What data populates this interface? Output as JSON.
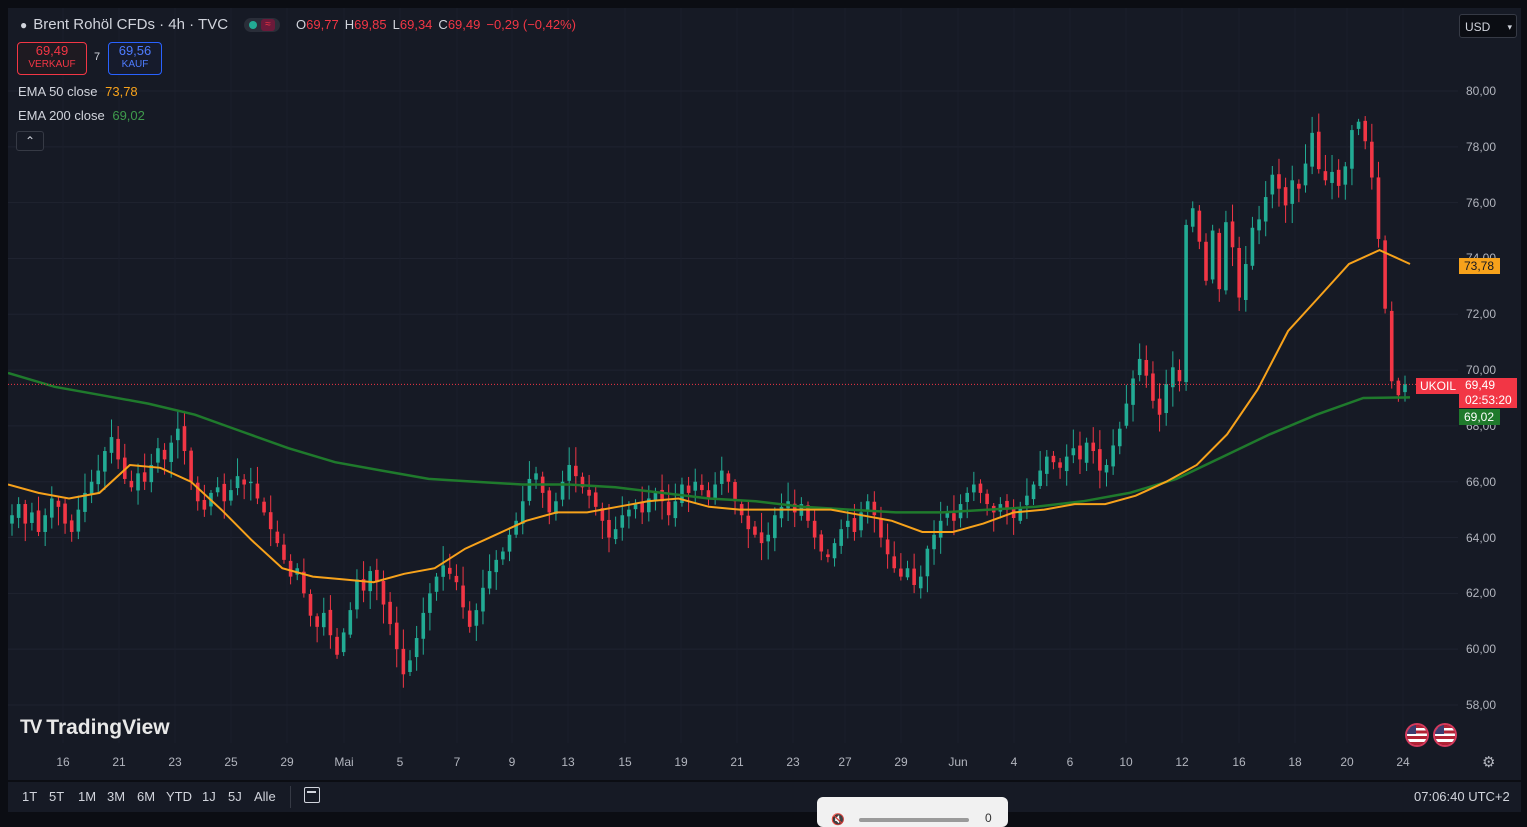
{
  "header": {
    "symbol_title": "Brent Rohöl CFDs · 4h · TVC",
    "ohlc": [
      {
        "k": "O",
        "v": "69,77"
      },
      {
        "k": "H",
        "v": "69,85"
      },
      {
        "k": "L",
        "v": "69,34"
      },
      {
        "k": "C",
        "v": "69,49"
      },
      {
        "k": "",
        "v": "−0,29 (−0,42%)"
      }
    ],
    "sell_price": "69,49",
    "sell_label": "VERKAUF",
    "spread": "7",
    "buy_price": "69,56",
    "buy_label": "KAUF",
    "ema50_label": "EMA 50 close",
    "ema50_value": "73,78",
    "ema200_label": "EMA 200 close",
    "ema200_value": "69,02",
    "collapse_glyph": "⌃",
    "currency": "USD",
    "currency_chevron": "▾"
  },
  "price_axis": [
    "80,00",
    "78,00",
    "76,00",
    "74,00",
    "72,00",
    "70,00",
    "68,00",
    "66,00",
    "64,00",
    "62,00",
    "60,00",
    "58,00"
  ],
  "date_axis": [
    "16",
    "21",
    "23",
    "25",
    "29",
    "Mai",
    "5",
    "7",
    "9",
    "13",
    "15",
    "19",
    "21",
    "23",
    "27",
    "29",
    "Jun",
    "4",
    "6",
    "10",
    "12",
    "16",
    "18",
    "20",
    "24"
  ],
  "tags": {
    "symbol": "UKOIL",
    "last_price": "69,49",
    "countdown": "02:53:20",
    "ema50": "73,78",
    "ema200": "69,02"
  },
  "brand": {
    "mark": "TV",
    "name": "TradingView"
  },
  "range_buttons": [
    "1T",
    "5T",
    "1M",
    "3M",
    "6M",
    "YTD",
    "1J",
    "5J",
    "Alle"
  ],
  "clock": "07:06:40 UTC+2",
  "audio": {
    "volume": "0",
    "mute_glyph": "🔇"
  },
  "colors": {
    "up": "#22ab94",
    "down": "#f23645",
    "ema50": "#f7a21b",
    "ema200": "#1f7a2c",
    "background": "#161a25"
  },
  "series": {
    "y_range": [
      57.3,
      80.7
    ],
    "closes": [
      64.8,
      65.2,
      64.5,
      64.9,
      64.2,
      64.8,
      65.4,
      65.1,
      64.5,
      64.2,
      65.0,
      65.6,
      66.0,
      66.4,
      67.1,
      67.6,
      66.8,
      66.1,
      65.8,
      66.3,
      66.0,
      66.6,
      67.2,
      66.8,
      67.4,
      67.9,
      67.1,
      66.0,
      65.3,
      65.0,
      65.6,
      65.8,
      65.3,
      65.7,
      66.2,
      65.9,
      66.0,
      65.4,
      64.9,
      64.3,
      63.8,
      63.2,
      62.6,
      62.9,
      62.0,
      61.2,
      60.8,
      61.3,
      60.5,
      59.8,
      60.6,
      61.4,
      62.5,
      62.1,
      62.8,
      62.4,
      61.6,
      60.9,
      60.0,
      59.1,
      59.6,
      60.4,
      61.3,
      62.0,
      62.6,
      63.0,
      62.7,
      62.4,
      61.5,
      60.8,
      61.4,
      62.2,
      62.8,
      63.2,
      63.5,
      64.1,
      64.6,
      65.3,
      66.1,
      66.3,
      65.6,
      64.9,
      65.3,
      66.0,
      66.6,
      66.2,
      65.8,
      65.5,
      65.1,
      64.6,
      64.0,
      64.3,
      64.8,
      65.0,
      65.2,
      64.9,
      65.4,
      65.6,
      65.3,
      64.8,
      65.3,
      65.9,
      65.6,
      66.0,
      65.7,
      65.4,
      65.9,
      66.4,
      66.0,
      65.3,
      64.8,
      64.3,
      64.1,
      63.8,
      64.1,
      64.8,
      65.1,
      65.3,
      64.9,
      65.2,
      64.6,
      64.0,
      63.5,
      63.3,
      63.8,
      64.3,
      64.6,
      64.2,
      64.9,
      65.3,
      64.8,
      64.0,
      63.4,
      62.9,
      62.6,
      62.9,
      62.3,
      62.6,
      63.6,
      64.1,
      64.6,
      64.9,
      64.6,
      65.2,
      65.6,
      65.9,
      65.6,
      65.2,
      64.9,
      65.2,
      65.0,
      64.7,
      65.1,
      65.5,
      65.9,
      66.4,
      66.9,
      66.7,
      66.5,
      66.9,
      67.2,
      66.8,
      67.4,
      67.1,
      66.4,
      66.6,
      67.3,
      67.9,
      68.8,
      69.7,
      70.4,
      69.8,
      68.9,
      68.4,
      69.5,
      70.1,
      69.6,
      75.2,
      75.8,
      74.6,
      73.2,
      75.0,
      72.9,
      75.3,
      74.4,
      72.6,
      73.8,
      75.1,
      75.4,
      76.2,
      77.0,
      76.5,
      75.9,
      76.8,
      76.5,
      77.4,
      78.5,
      77.2,
      76.8,
      77.1,
      76.6,
      77.3,
      78.6,
      78.9,
      78.2,
      76.9,
      74.7,
      72.2,
      69.6,
      69.1,
      69.49
    ],
    "ema50": [
      65.9,
      65.6,
      65.4,
      65.6,
      66.6,
      66.5,
      66.0,
      65.0,
      63.9,
      62.9,
      62.6,
      62.5,
      62.4,
      62.7,
      62.9,
      63.6,
      64.1,
      64.6,
      64.9,
      64.9,
      65.1,
      65.3,
      65.4,
      65.1,
      65.0,
      65.0,
      65.0,
      65.0,
      64.8,
      64.6,
      64.2,
      64.2,
      64.5,
      64.9,
      65.0,
      65.2,
      65.2,
      65.5,
      66.0,
      66.6,
      67.7,
      69.3,
      71.4,
      72.6,
      73.8,
      74.3,
      73.8
    ],
    "ema200": [
      69.9,
      69.4,
      69.1,
      68.8,
      68.4,
      67.8,
      67.2,
      66.7,
      66.4,
      66.1,
      66.0,
      65.9,
      65.9,
      65.8,
      65.6,
      65.4,
      65.3,
      65.1,
      65.0,
      64.9,
      64.9,
      65.0,
      65.1,
      65.3,
      65.6,
      66.1,
      66.9,
      67.7,
      68.4,
      69.0,
      69.02
    ]
  }
}
